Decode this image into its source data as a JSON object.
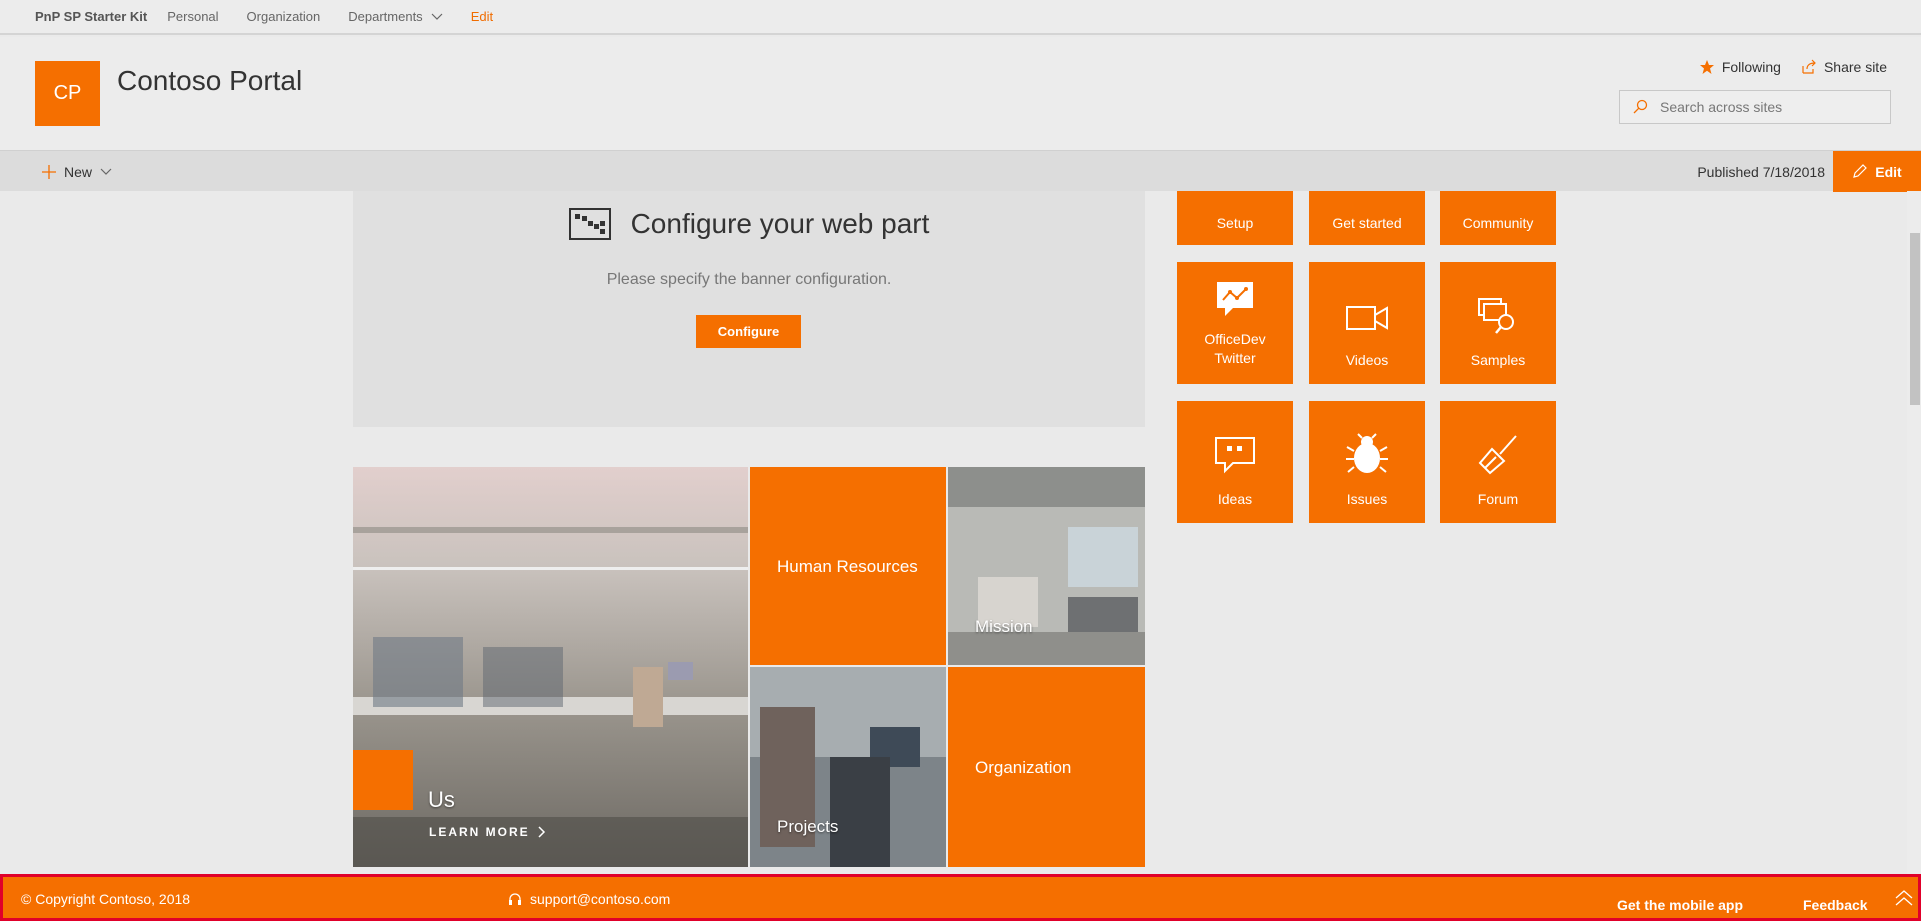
{
  "topnav": {
    "brand": "PnP SP Starter Kit",
    "links": [
      "Personal",
      "Organization",
      "Departments"
    ],
    "edit": "Edit"
  },
  "header": {
    "logo_text": "CP",
    "title": "Contoso Portal",
    "following": "Following",
    "share": "Share site",
    "search_placeholder": "Search across sites"
  },
  "commandbar": {
    "new_label": "New",
    "published": "Published 7/18/2018",
    "edit_label": "Edit"
  },
  "banner_config": {
    "title": "Configure your web part",
    "description": "Please specify the banner configuration.",
    "button": "Configure"
  },
  "tiles": {
    "top": [
      "Setup",
      "Get started",
      "Community"
    ],
    "middle": [
      {
        "label": "OfficeDev Twitter",
        "icon": "chat-graph-icon"
      },
      {
        "label": "Videos",
        "icon": "video-camera-icon"
      },
      {
        "label": "Samples",
        "icon": "search-documents-icon"
      }
    ],
    "bottom": [
      {
        "label": "Ideas",
        "icon": "quote-bubble-icon"
      },
      {
        "label": "Issues",
        "icon": "bug-icon"
      },
      {
        "label": "Forum",
        "icon": "broom-icon"
      }
    ]
  },
  "hero": {
    "main_title": "Us",
    "learn_more": "LEARN MORE",
    "human_resources": "Human Resources",
    "mission": "Mission",
    "projects": "Projects",
    "organization": "Organization"
  },
  "footer": {
    "copyright": "© Copyright Contoso, 2018",
    "support": "support@contoso.com",
    "mobile": "Get the mobile app",
    "feedback": "Feedback"
  },
  "colors": {
    "accent": "#f56f00",
    "highlight_border": "#e0002a"
  }
}
